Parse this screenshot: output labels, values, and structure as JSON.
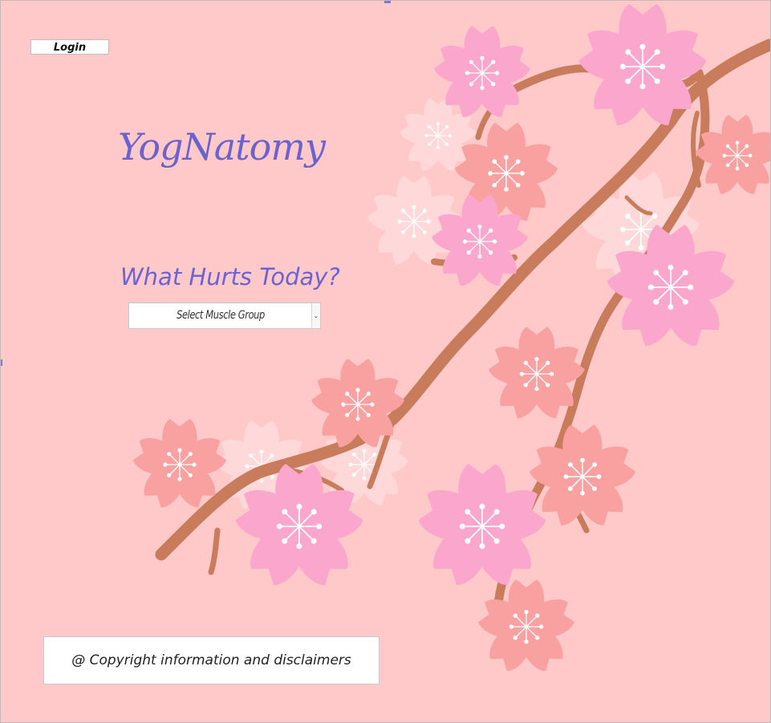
{
  "header": {
    "login_label": "Login"
  },
  "brand": {
    "logo_text": "YogNatomy"
  },
  "main": {
    "question": "What Hurts Today?",
    "muscle_select": {
      "selected": "Select Muscle Group"
    }
  },
  "footer": {
    "text": "@ Copyright information and disclaimers"
  },
  "colors": {
    "background": "#ffc9c9",
    "accent": "#6a63cf",
    "branch": "#c87c5c",
    "blossom_pink": "#fba6cc",
    "blossom_coral": "#f9a1a1",
    "blossom_pale": "#ffd9d9"
  },
  "icons": {
    "dropdown": "chevron-down-icon"
  }
}
